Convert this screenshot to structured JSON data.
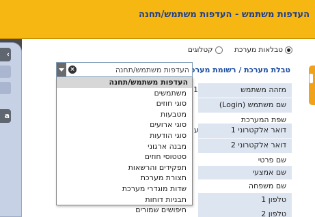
{
  "header": {
    "title": "העדפות משתמש - העדפות משתמש/תחנה",
    "color": "#f7b712",
    "title_color": "#1f3e8c"
  },
  "radio_options": [
    {
      "label": "טבלאות מערכת",
      "checked": true
    },
    {
      "label": "קטלוגים",
      "checked": false
    }
  ],
  "system_table_label": "טבלת מערכת / רשומת מערכת:",
  "combo": {
    "value": "העדפות משתמש/תחנה",
    "clear_icon": "close-circle-icon",
    "dropdown_icon": "chevron-down-icon"
  },
  "dropdown_items": [
    "העדפות משתמש/תחנה",
    "משתמשים",
    "סוגי חוזים",
    "מטבעות",
    "סוגי ארועים",
    "סוגי הודעות",
    "מבנה ארגוני",
    "סטטוסי חוזים",
    "תפקידים והרשאות",
    "תצורת מערכת",
    "שדות מוגדרי מערכת",
    "תבניות דוחות",
    "חיפושים שמורים"
  ],
  "field_rows": [
    {
      "label": "מזהה משתמש",
      "mark": "1"
    },
    {
      "label": "שם משתמש (Login)",
      "mark": ""
    },
    {
      "label": "שפת המערכת",
      "mark": ""
    },
    {
      "label": "דואר אלקטרוני 1",
      "mark": "ע"
    },
    {
      "label": "דואר אלקטרוני 2",
      "mark": ""
    },
    {
      "label": "שם פרטי",
      "mark": ""
    },
    {
      "label": "שם אמצעי",
      "mark": ""
    },
    {
      "label": "שם משפחה",
      "mark": ""
    },
    {
      "label": "טלפון 1",
      "mark": ""
    },
    {
      "label": "טלפון 2",
      "mark": ""
    }
  ],
  "left_buttons": [
    {
      "glyph": "‹"
    },
    {
      "glyph": "a"
    }
  ],
  "accent_colors": {
    "sidebar": "#c7d1e5",
    "label_blue": "#1f4fa0",
    "row_bg": "#dde5f1",
    "right_tab": "#f0a21a"
  }
}
